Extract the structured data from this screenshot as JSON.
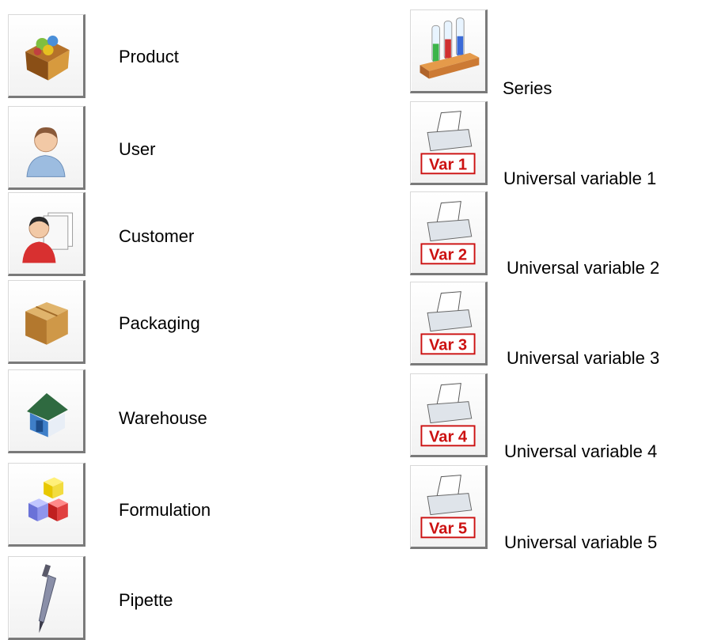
{
  "left_items": [
    {
      "label": "Product",
      "icon": "product-box-icon"
    },
    {
      "label": "User",
      "icon": "user-icon"
    },
    {
      "label": "Customer",
      "icon": "customer-icon"
    },
    {
      "label": "Packaging",
      "icon": "package-box-icon"
    },
    {
      "label": "Warehouse",
      "icon": "warehouse-house-icon"
    },
    {
      "label": "Formulation",
      "icon": "formulation-blocks-icon"
    },
    {
      "label": "Pipette",
      "icon": "pipette-icon"
    }
  ],
  "right_items": [
    {
      "label": "Series",
      "icon": "series-test-tubes-icon"
    },
    {
      "label": "Universal variable 1",
      "icon": "printer-var-icon",
      "badge": "Var 1"
    },
    {
      "label": "Universal variable 2",
      "icon": "printer-var-icon",
      "badge": "Var 2"
    },
    {
      "label": "Universal variable 3",
      "icon": "printer-var-icon",
      "badge": "Var 3"
    },
    {
      "label": "Universal variable 4",
      "icon": "printer-var-icon",
      "badge": "Var 4"
    },
    {
      "label": "Universal variable 5",
      "icon": "printer-var-icon",
      "badge": "Var 5"
    }
  ],
  "colors": {
    "badge_red": "#cc1111",
    "button_shadow": "#7a7a7a"
  }
}
